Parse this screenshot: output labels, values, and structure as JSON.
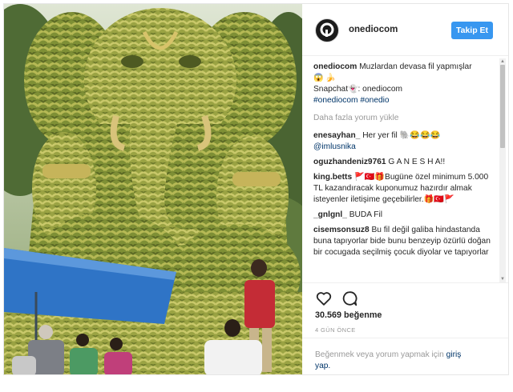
{
  "post": {
    "username": "onediocom",
    "follow_label": "Takip Et",
    "caption": {
      "username": "onediocom",
      "text": "Muzlardan devasa fil yapmışlar",
      "emoji": "😱 🍌",
      "snapchat_label": "Snapchat",
      "snapchat_emoji": "👻",
      "snapchat_value": ": onediocom",
      "hashtags": "#onediocom #onedio"
    },
    "load_more_label": "Daha fazla yorum yükle",
    "comments": [
      {
        "username": "enesayhan_",
        "text": "Her yer fil 🐘😂😂😂",
        "extra": "@imlusnika"
      },
      {
        "username": "oguzhandeniz9761",
        "text": "G A N E S H A!!"
      },
      {
        "username": "king.betts",
        "text": "🚩🇹🇷🎁Bugüne özel minimum 5.000 TL kazandıracak kuponumuz hazırdır almak isteyenler iletişime geçebilirler.🎁🇹🇷🚩"
      },
      {
        "username": "_gnlgnl_",
        "text": "BUDA Fil"
      },
      {
        "username": "cisemsonsuz8",
        "text": "Bu fil değil galiba hindastanda buna tapıyorlar bide bunu benzeyip özürlü doğan bir cocugada seçilmiş çocuk diyolar ve tapıyorlar"
      }
    ],
    "likes_label": "30.569 beğenme",
    "time_label": "4 GÜN ÖNCE",
    "login_prompt": "Beğenmek veya yorum yapmak için",
    "login_link": "giriş yap."
  },
  "icons": {
    "like": "heart-outline-icon",
    "comment": "speech-bubble-icon",
    "avatar": "onedio-logo"
  },
  "colors": {
    "accent": "#3897f0",
    "link": "#003569",
    "muted": "#999999",
    "text": "#262626"
  }
}
